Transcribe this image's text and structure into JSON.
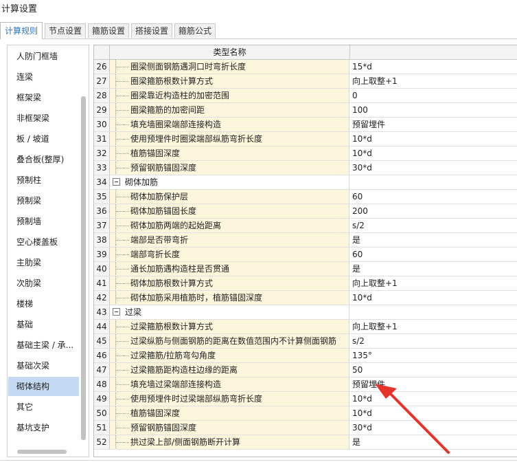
{
  "window": {
    "title": "计算设置"
  },
  "tabs": [
    {
      "label": "计算规则",
      "active": true
    },
    {
      "label": "节点设置",
      "active": false
    },
    {
      "label": "箍筋设置",
      "active": false
    },
    {
      "label": "搭接设置",
      "active": false
    },
    {
      "label": "箍筋公式",
      "active": false
    }
  ],
  "sidebar": {
    "selected": "砌体结构",
    "items": [
      "人防门框墙",
      "连梁",
      "框架梁",
      "非框架梁",
      "板 / 坡道",
      "叠合板(整厚)",
      "预制柱",
      "预制梁",
      "预制墙",
      "空心楼盖板",
      "主肋梁",
      "次肋梁",
      "楼梯",
      "基础",
      "基础主梁 / 承...",
      "基础次梁",
      "砌体结构",
      "其它",
      "基坑支护"
    ]
  },
  "grid": {
    "header": {
      "name": "类型名称",
      "value": ""
    },
    "rows": [
      {
        "num": "26",
        "name": "圈梁侧面钢筋遇洞口时弯折长度",
        "value": "15*d",
        "group": false
      },
      {
        "num": "27",
        "name": "圈梁箍筋根数计算方式",
        "value": "向上取整+1",
        "group": false
      },
      {
        "num": "28",
        "name": "圈梁靠近构造柱的加密范围",
        "value": "0",
        "group": false
      },
      {
        "num": "29",
        "name": "圈梁箍筋的加密间距",
        "value": "100",
        "group": false
      },
      {
        "num": "30",
        "name": "填充墙圈梁端部连接构造",
        "value": "预留埋件",
        "group": false
      },
      {
        "num": "31",
        "name": "使用预埋件时圈梁端部纵筋弯折长度",
        "value": "10*d",
        "group": false
      },
      {
        "num": "32",
        "name": "植筋锚固深度",
        "value": "10*d",
        "group": false
      },
      {
        "num": "33",
        "name": "预留钢筋锚固深度",
        "value": "30*d",
        "group": false
      },
      {
        "num": "34",
        "name": "砌体加筋",
        "value": "",
        "group": true
      },
      {
        "num": "35",
        "name": "砌体加筋保护层",
        "value": "60",
        "group": false
      },
      {
        "num": "36",
        "name": "砌体加筋锚固长度",
        "value": "200",
        "group": false
      },
      {
        "num": "37",
        "name": "砌体加筋两端的起始距离",
        "value": "s/2",
        "group": false
      },
      {
        "num": "38",
        "name": "端部是否带弯折",
        "value": "是",
        "group": false
      },
      {
        "num": "39",
        "name": "端部弯折长度",
        "value": "60",
        "group": false
      },
      {
        "num": "40",
        "name": "通长加筋遇构造柱是否贯通",
        "value": "是",
        "group": false
      },
      {
        "num": "41",
        "name": "砌体加筋根数计算方式",
        "value": "向上取整+1",
        "group": false
      },
      {
        "num": "42",
        "name": "砌体加筋采用植筋时，植筋锚固深度",
        "value": "10*d",
        "group": false
      },
      {
        "num": "43",
        "name": "过梁",
        "value": "",
        "group": true
      },
      {
        "num": "44",
        "name": "过梁箍筋根数计算方式",
        "value": "向上取整+1",
        "group": false
      },
      {
        "num": "45",
        "name": "过梁纵筋与侧面钢筋的距离在数值范围内不计算侧面钢筋",
        "value": "s/2",
        "group": false
      },
      {
        "num": "46",
        "name": "过梁箍筋/拉筋弯勾角度",
        "value": "135°",
        "group": false
      },
      {
        "num": "47",
        "name": "过梁箍筋距构造柱边缘的距离",
        "value": "50",
        "group": false
      },
      {
        "num": "48",
        "name": "填充墙过梁端部连接构造",
        "value": "预留埋件",
        "group": false
      },
      {
        "num": "49",
        "name": "使用预埋件时过梁端部纵筋弯折长度",
        "value": "10*d",
        "group": false
      },
      {
        "num": "50",
        "name": "植筋锚固深度",
        "value": "10*d",
        "group": false
      },
      {
        "num": "51",
        "name": "预留钢筋锚固深度",
        "value": "30*d",
        "group": false
      },
      {
        "num": "52",
        "name": "拱过梁上部/侧面钢筋断开计算",
        "value": "是",
        "group": false
      }
    ]
  },
  "annotation": {
    "arrow_color": "#e8332a"
  }
}
